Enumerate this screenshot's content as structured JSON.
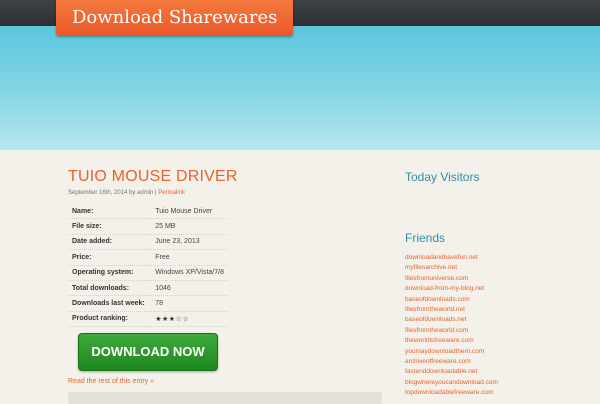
{
  "site": {
    "title": "Download Sharewares"
  },
  "post": {
    "title": "TUIO MOUSE DRIVER",
    "meta_text": "September 16th, 2014 by admin |",
    "permalink_label": "Permalink",
    "details": [
      {
        "label": "Name:",
        "value": "Tuio Mouse Driver"
      },
      {
        "label": "File size:",
        "value": "25 MB"
      },
      {
        "label": "Date added:",
        "value": "June 23, 2013"
      },
      {
        "label": "Price:",
        "value": "Free"
      },
      {
        "label": "Operating system:",
        "value": "Windows XP/Vista/7/8"
      },
      {
        "label": "Total downloads:",
        "value": "1046"
      },
      {
        "label": "Downloads last week:",
        "value": "78"
      },
      {
        "label": "Product ranking:",
        "value": "★★★☆☆"
      }
    ],
    "rating": {
      "stars": 3,
      "max": 5
    },
    "download_button": "DOWNLOAD NOW",
    "read_more": "Read the rest of this entry »"
  },
  "sidebar": {
    "today_visitors_title": "Today Visitors",
    "friends_title": "Friends",
    "friends": [
      "downloadandhavefun.net",
      "myfilesarchive.net",
      "filesfromuniverse.com",
      "download-from-my-blog.net",
      "baseofdownloads.com",
      "filesfromtheworld.net",
      "baseofdownloads.net",
      "filesfromtheworld.com",
      "theworldisfreeware.com",
      "youmaydownloadthem.com",
      "archiveoffreeware.com",
      "fastenddownloadable.net",
      "blogwhereyoucandownload.com",
      "topdownloadablefreeware.com"
    ]
  },
  "colors": {
    "accent_orange": "#e8622d",
    "heading_blue": "#2f8fa8",
    "button_green": "#2a9b2a",
    "sky_blue": "#5ac6dc"
  }
}
